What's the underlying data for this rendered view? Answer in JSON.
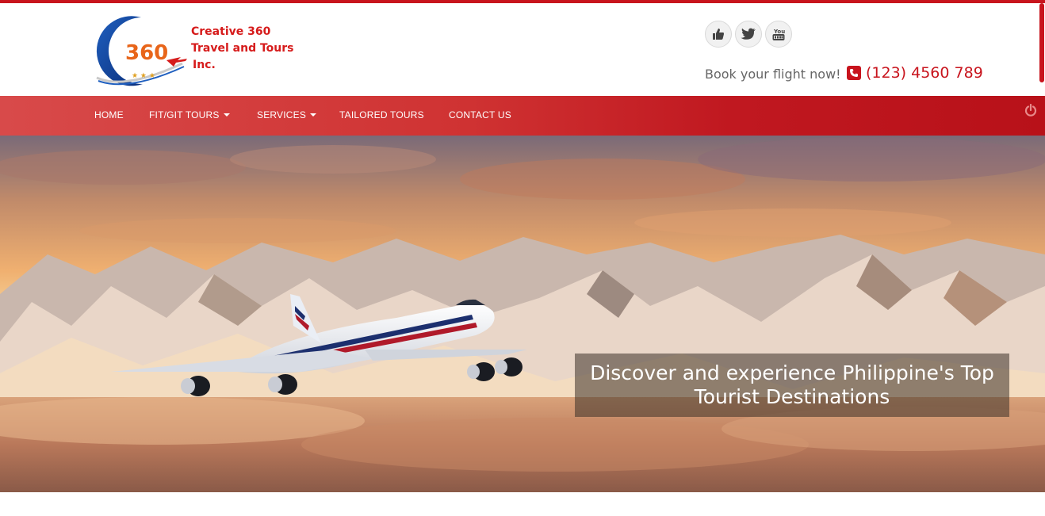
{
  "header": {
    "logo": {
      "number": "360",
      "line1": "Creative 360",
      "line2": "Travel and Tours",
      "line3": "Inc."
    },
    "social_icons": [
      "thumbs-up-icon",
      "twitter-icon",
      "youtube-icon"
    ],
    "book_text": "Book your flight now!",
    "phone_icon": "phone-square-icon",
    "phone": "(123) 4560 789"
  },
  "nav": {
    "items": [
      {
        "label": "HOME",
        "dropdown": false
      },
      {
        "label": "FIT/GIT TOURS",
        "dropdown": true
      },
      {
        "label": "SERVICES",
        "dropdown": true
      },
      {
        "label": "TAILORED TOURS",
        "dropdown": false
      },
      {
        "label": "CONTACT US",
        "dropdown": false
      }
    ],
    "power_icon": "power-icon"
  },
  "hero": {
    "caption_line1": "Discover and experience Philippine's Top",
    "caption_line2": "Tourist Destinations"
  },
  "colors": {
    "brand_red": "#c8141d",
    "nav_start": "#d84a4a",
    "nav_end": "#b81119",
    "text_gray": "#666666"
  }
}
